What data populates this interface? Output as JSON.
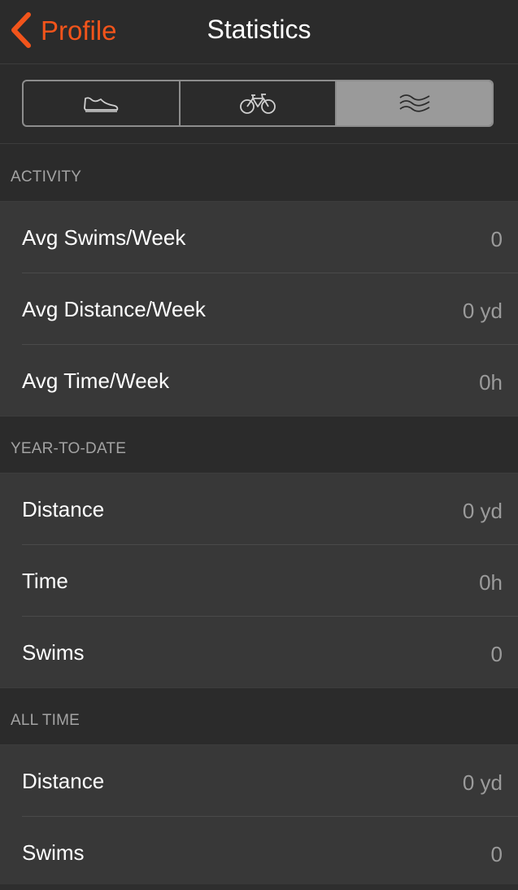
{
  "nav": {
    "back_label": "Profile",
    "title": "Statistics",
    "accent_color": "#f2541b"
  },
  "segments": [
    {
      "icon": "shoe-icon",
      "active": false
    },
    {
      "icon": "bicycle-icon",
      "active": false
    },
    {
      "icon": "waves-icon",
      "active": true
    }
  ],
  "sections": {
    "activity": {
      "header": "ACTIVITY",
      "rows": [
        {
          "label": "Avg Swims/Week",
          "value": "0"
        },
        {
          "label": "Avg Distance/Week",
          "value": "0 yd"
        },
        {
          "label": "Avg Time/Week",
          "value": "0h"
        }
      ]
    },
    "ytd": {
      "header": "YEAR-TO-DATE",
      "rows": [
        {
          "label": "Distance",
          "value": "0 yd"
        },
        {
          "label": "Time",
          "value": "0h"
        },
        {
          "label": "Swims",
          "value": "0"
        }
      ]
    },
    "alltime": {
      "header": "ALL TIME",
      "rows": [
        {
          "label": "Distance",
          "value": "0 yd"
        },
        {
          "label": "Swims",
          "value": "0"
        }
      ]
    }
  }
}
